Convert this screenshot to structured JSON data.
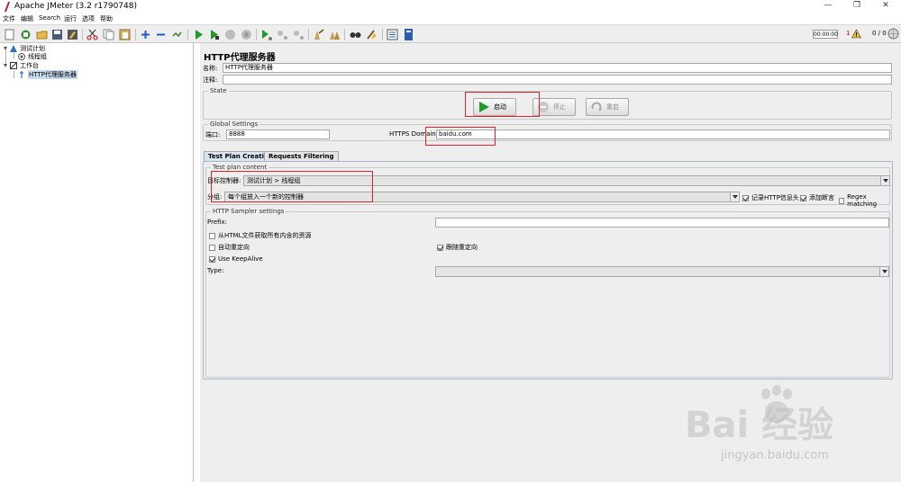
{
  "window": {
    "title": "Apache JMeter (3.2 r1790748)",
    "minimize": "—",
    "maximize": "❐",
    "close": "✕"
  },
  "menu": [
    "文件",
    "编辑",
    "Search",
    "运行",
    "选项",
    "帮助"
  ],
  "status": {
    "timer": "00:00:00",
    "warnings": "1",
    "threads": "0 / 0"
  },
  "tree": {
    "items": [
      {
        "label": "测试计划"
      },
      {
        "label": "线程组"
      },
      {
        "label": "工作台"
      },
      {
        "label": "HTTP代理服务器"
      }
    ]
  },
  "panel": {
    "title": "HTTP代理服务器",
    "name_label": "名称:",
    "name_value": "HTTP代理服务器",
    "comment_label": "注释:",
    "comment_value": "",
    "state": {
      "title": "State",
      "start": "启动",
      "stop": "停止",
      "restart": "重启"
    },
    "global": {
      "title": "Global Settings",
      "port_label": "端口:",
      "port_value": "8888",
      "https_label": "HTTPS Domains :",
      "https_value": "baidu.com"
    },
    "tabs": [
      "Test Plan Creation",
      "Requests Filtering"
    ],
    "test_plan": {
      "title": "Test plan content",
      "target_label": "目标控制器:",
      "target_value": "测试计划 > 线程组",
      "group_label": "分组:",
      "group_value": "每个组放入一个新的控制器",
      "record_headers": "记录HTTP信息头",
      "add_assertions": "添加断言",
      "regex_matching": "Regex matching"
    },
    "sampler": {
      "title": "HTTP Sampler settings",
      "prefix_label": "Prefix:",
      "prefix_value": "",
      "retrieve_resources": "从HTML文件获取所有内含的资源",
      "auto_redirect": "自动重定向",
      "follow_redirects": "跟随重定向",
      "keepalive": "Use KeepAlive",
      "type_label": "Type:",
      "type_value": ""
    }
  },
  "colors": {
    "highlight_box": "#e0232b",
    "tab_active": "#d9e4f1",
    "background": "#eeeeee"
  }
}
